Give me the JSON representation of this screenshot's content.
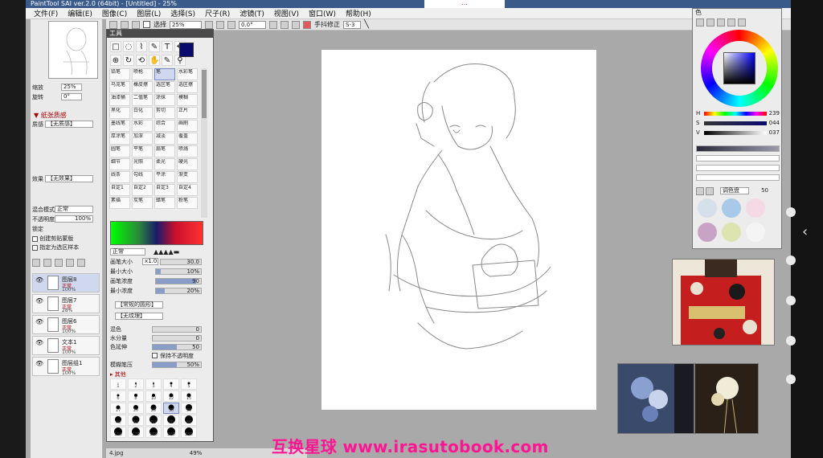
{
  "window": {
    "title": "PaintTool SAI ver.2.0 (64bit) - [Untitled] - 25%",
    "tab_label": "…"
  },
  "menu": {
    "items": [
      "文件(F)",
      "编辑(E)",
      "图像(C)",
      "图层(L)",
      "选择(S)",
      "尺子(R)",
      "滤镜(T)",
      "视图(V)",
      "窗口(W)",
      "帮助(H)"
    ]
  },
  "toolbar": {
    "select_label": "选择",
    "zoom_value": "25%",
    "angle_value": "0.0°",
    "stabilizer_label": "手抖修正",
    "stabilizer_value": "S-3"
  },
  "left_panel": {
    "zoom_label": "缩放",
    "zoom_value": "25%",
    "rotate_label": "旋转",
    "rotate_value": "0°",
    "texture_head": "▼ 纸张质感",
    "texture_label": "质感",
    "texture_value": "【无质感】",
    "effect_label": "效果",
    "effect_value": "【无效果】",
    "blend_label": "混合模式",
    "blend_value": "正常",
    "opacity_label": "不透明度",
    "opacity_value": "100%",
    "lock_label": "锁定",
    "clip_group_label": "创建剪贴蒙版",
    "selection_source_label": "指定为选区样本"
  },
  "layers": [
    {
      "name": "图层8",
      "mode": "正常",
      "opacity": "100%",
      "active": true
    },
    {
      "name": "图层7",
      "mode": "正常",
      "opacity": "28%",
      "active": false
    },
    {
      "name": "图层6",
      "mode": "正常",
      "opacity": "100%",
      "active": false
    },
    {
      "name": "文本1",
      "mode": "正常",
      "opacity": "100%",
      "active": false
    },
    {
      "name": "图层组1",
      "mode": "正常",
      "opacity": "100%",
      "active": false
    }
  ],
  "tool_panel": {
    "title": "工具",
    "tool_icons": [
      "□",
      "◌",
      "⌇",
      "✎",
      "T",
      "✥",
      "⊕",
      "↻",
      "⟲",
      "✋",
      "✎",
      "⚲"
    ],
    "brushes": [
      "铅笔",
      "喷枪",
      "笔",
      "水彩笔",
      "马克笔",
      "橡皮擦",
      "选区笔",
      "选区擦",
      "油漆桶",
      "二值笔",
      "涂抹",
      "模糊",
      "黑化",
      "白化",
      "剪切",
      "正片",
      "墨线笔",
      "水彩",
      "综合",
      "画刷",
      "厚涂笔",
      "加深",
      "减淡",
      "覆盖",
      "圆笔",
      "平笔",
      "扇笔",
      "喷溅",
      "细节",
      "光照",
      "柔光",
      "硬光",
      "线条",
      "勾线",
      "平涂",
      "渐变",
      "自定1",
      "自定2",
      "自定3",
      "自定4",
      "素描",
      "炭笔",
      "蜡笔",
      "粉笔"
    ],
    "selected_brush_index": 2,
    "props": {
      "mode_label": "正常",
      "size_label": "画笔大小",
      "size_mult": "x1.0",
      "size_value": "30.0",
      "min_size_label": "最小大小",
      "min_size_value": "10%",
      "density_label": "画笔浓度",
      "density_value": "90",
      "min_density_label": "最小浓度",
      "min_density_value": "20%",
      "shape_value": "【常规的圆形】",
      "texture_value": "【无纹理】",
      "blend_label": "混色",
      "blend_value": "0",
      "dilution_label": "水分量",
      "dilution_value": "0",
      "persistence_label": "色延伸",
      "persistence_value": "50",
      "keep_opacity_label": "保持不透明度",
      "blur_label": "模糊笔压",
      "blur_value": "50%",
      "other_head": "▸ 其他"
    },
    "size_presets": [
      "1",
      "2",
      "3",
      "4",
      "5",
      "6",
      "8",
      "10",
      "12",
      "15",
      "17",
      "20",
      "25",
      "30",
      "35",
      "40",
      "50",
      "60",
      "70",
      "80",
      "100",
      "120",
      "160",
      "200",
      "250"
    ],
    "selected_size_index": 13
  },
  "color_panel": {
    "title": "色",
    "h_label": "H",
    "h_value": "239",
    "s_label": "S",
    "s_value": "044",
    "v_label": "V",
    "v_value": "037",
    "palette_label": "调色盘",
    "palette_value": "50",
    "main_color": "#0a0a6e",
    "swatches": [
      "#d5e0ea",
      "#a9c9ea",
      "#f5d9e4",
      "#c9a3c6",
      "#dde4b0",
      "#f4f4f4"
    ]
  },
  "status": {
    "file": "4.jpg",
    "zoom": "49%"
  },
  "watermark": "互换星球 www.irasutobook.com"
}
